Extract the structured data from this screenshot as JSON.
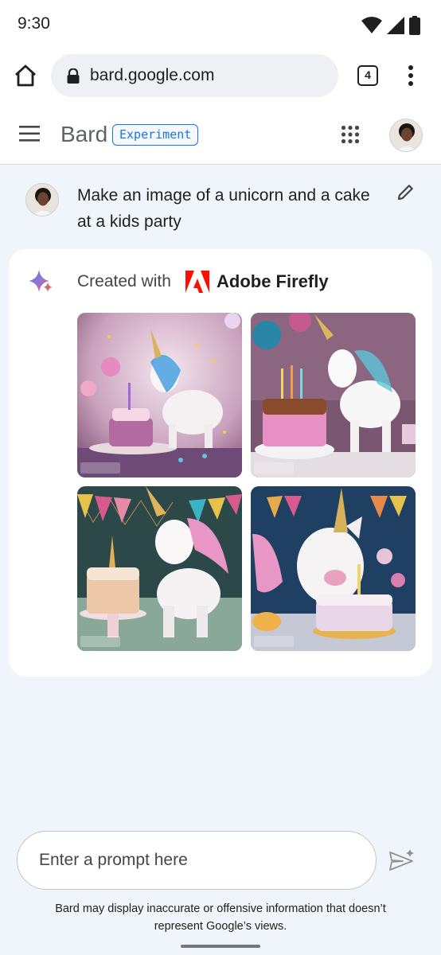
{
  "status_bar": {
    "time": "9:30",
    "icons": [
      "wifi-icon",
      "cellular-icon",
      "battery-icon"
    ]
  },
  "browser": {
    "url": "bard.google.com",
    "tab_count": "4",
    "icons": [
      "home-icon",
      "lock-icon",
      "more-vert-icon"
    ]
  },
  "app_header": {
    "brand": "Bard",
    "badge": "Experiment",
    "icons": [
      "menu-icon",
      "apps-icon",
      "account-avatar"
    ]
  },
  "conversation": {
    "user_prompt": "Make an image of a unicorn and a cake at a kids party",
    "response": {
      "created_with_label": "Created with",
      "provider": "Adobe Firefly",
      "images": [
        {
          "theme": "unicorn-cake-purple",
          "watermark": "Adobe Firefly (Beta)"
        },
        {
          "theme": "unicorn-cake-balloons",
          "watermark": "Adobe Firefly (Beta)"
        },
        {
          "theme": "unicorn-cake-bunting",
          "watermark": "Adobe Firefly (Beta)"
        },
        {
          "theme": "unicorn-cake-night",
          "watermark": "Adobe Firefly (Beta)"
        }
      ]
    }
  },
  "input": {
    "placeholder": "Enter a prompt here",
    "value": ""
  },
  "disclaimer": "Bard may display inaccurate or offensive information that doesn’t represent Google’s views.",
  "colors": {
    "accent": "#1a73e8",
    "background": "#f0f4fb",
    "adobe_red": "#fa0f00"
  }
}
